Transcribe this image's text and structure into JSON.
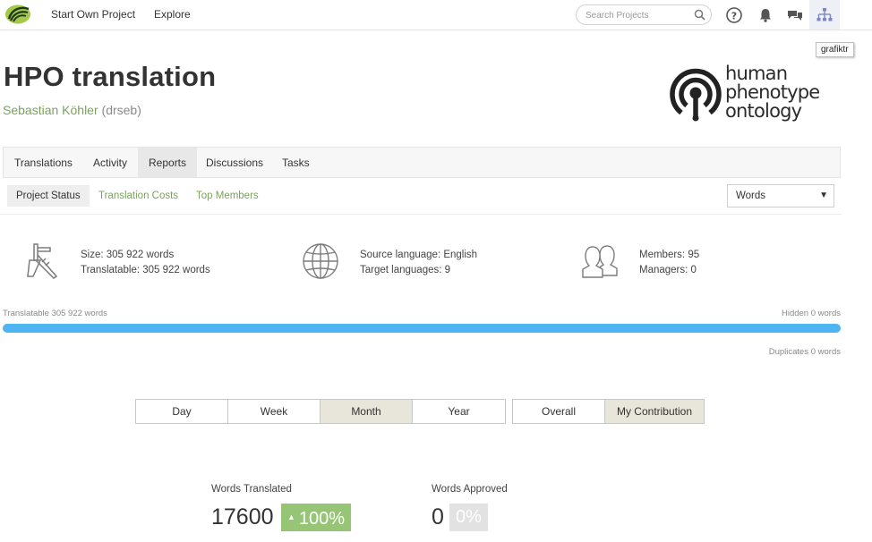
{
  "nav": {
    "links": [
      "Start Own Project",
      "Explore"
    ],
    "search_placeholder": "Search Projects",
    "icons": [
      "crowdin-logo-icon",
      "help-icon",
      "bell-icon",
      "messages-icon",
      "crowdin-hierarchy-icon"
    ],
    "tooltip": "grafiktr"
  },
  "project": {
    "title": "HPO translation",
    "owner_name": "Sebastian Köhler",
    "owner_handle": "(drseb)",
    "logo_text": [
      "human",
      "phenotype",
      "ontology"
    ]
  },
  "tabs": [
    "Translations",
    "Activity",
    "Reports",
    "Discussions",
    "Tasks"
  ],
  "active_tab": "Reports",
  "subtabs": [
    "Project Status",
    "Translation Costs",
    "Top Members"
  ],
  "active_subtab": "Project Status",
  "unit_select": {
    "value": "Words",
    "arrow": "▼"
  },
  "stats": {
    "size": "Size: 305 922 words",
    "translatable": "Translatable: 305 922 words",
    "source_language": "Source language: English",
    "target_languages": "Target languages: 9",
    "members": "Members: 95",
    "managers": "Managers: 0"
  },
  "progress": {
    "left_label": "Translatable 305 922 words",
    "right_label": "Hidden 0 words",
    "duplicates_label": "Duplicates 0 words",
    "translatable_fraction": 1.0
  },
  "periods": [
    "Day",
    "Week",
    "Month",
    "Year"
  ],
  "active_period": "Month",
  "scopes": [
    "Overall",
    "My Contribution"
  ],
  "active_scope": "My Contribution",
  "metrics": {
    "translated_label": "Words Translated",
    "translated_value": "17600",
    "translated_change": "100%",
    "translated_change_arrow": "▲",
    "approved_label": "Words Approved",
    "approved_value": "0",
    "approved_change": "0%"
  },
  "colors": {
    "brand_green": "#7aa25c",
    "progress_blue": "#4fb5f2",
    "badge_green": "#96c675",
    "active_button": "#e8e5da"
  }
}
